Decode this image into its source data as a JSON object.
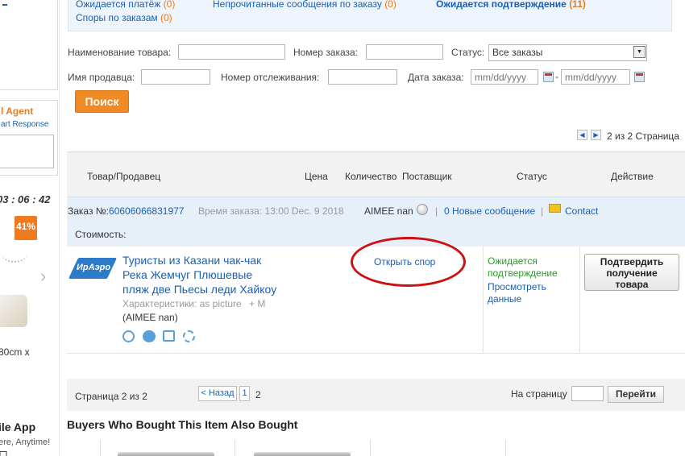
{
  "status_summary": {
    "awaiting_payment_label": "Ожидается платёж",
    "awaiting_payment_count": "(0)",
    "unread_messages_label": "Непрочитанные сообщения по заказу",
    "unread_messages_count": "(0)",
    "awaiting_confirmation_label": "Ожидается подтверждение",
    "awaiting_confirmation_count": "(11)",
    "disputes_label": "Споры по заказам",
    "disputes_count": "(0)"
  },
  "left_sidebar": {
    "agent_title": "l Agent",
    "agent_subtitle": "art Response",
    "countdown": "03 : 06 : 42",
    "discount_badge": "41%",
    "size_text": "80cm x",
    "app_title": "ile App",
    "app_subtitle": "ere, Anytime!",
    "bottom_glyph": "口"
  },
  "filters": {
    "product_name_label": "Наименование товара:",
    "order_number_label": "Номер заказа:",
    "status_label": "Статус:",
    "status_value": "Все заказы",
    "seller_name_label": "Имя продавца:",
    "tracking_label": "Номер отслеживания:",
    "order_date_label": "Дата заказа:",
    "date_from_placeholder": "mm/dd/yyyy",
    "date_to_placeholder": "mm/dd/yyyy",
    "date_separator": "-",
    "search_button": "Поиск"
  },
  "top_pagination": {
    "prev_arrow": "◀",
    "next_arrow": "▶",
    "text": "2 из 2 Страница"
  },
  "table_header": {
    "product_seller": "Товар/Продавец",
    "price": "Цена",
    "quantity": "Количество",
    "supplier": "Поставщик",
    "status": "Статус",
    "action": "Действие"
  },
  "order": {
    "number_label": "Заказ №:",
    "number": "60606066831977",
    "time_label": "Время заказа:",
    "time_value": "13:00 Dec. 9 2018",
    "seller": "AIMEE nan",
    "new_messages_count": "0",
    "new_messages_label": "Новые сообщение",
    "separator": "|",
    "contact": "Contact",
    "cost_label": "Стоимость:",
    "logo_text": "ИрАэро",
    "product_title_lines": [
      "Туристы из Казани чак-чак",
      "Река Жемчуг Плюшевые",
      "пляж две Пьесы леди Хайкоу"
    ],
    "characteristics_label": "Характеристики:",
    "characteristics_value": "as picture",
    "size_value": "+ M",
    "seller_paren": "(AIMEE nan)",
    "open_dispute": "Открыть спор",
    "status_lines": [
      "Ожидается",
      "подтверждение"
    ],
    "view_data_lines": [
      "Просмотреть",
      "данные"
    ],
    "confirm_button_lines": [
      "Подтвердить",
      "получение",
      "товара"
    ]
  },
  "bottom_pagination": {
    "page_info": "Страница 2 из 2",
    "back_button": "< Назад",
    "page_1": "1",
    "page_2": "2",
    "go_to_label": "На страницу",
    "go_button": "Перейти"
  },
  "related": {
    "title": "Buyers Who Bought This Item Also Bought"
  },
  "colors": {
    "link": "#1a5fb4",
    "orange": "#e87c1a",
    "status_green": "#2a9a2a",
    "annotation_red": "#cc1111",
    "search_button": "#f08a24"
  }
}
